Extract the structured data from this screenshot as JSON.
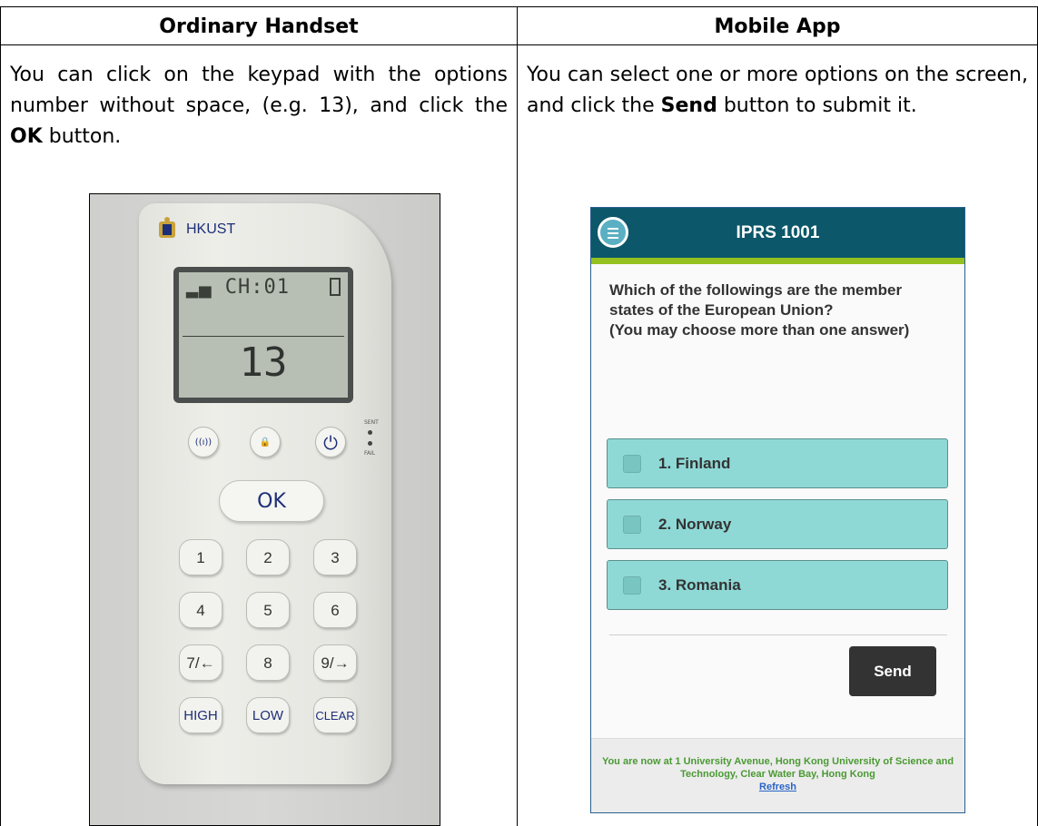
{
  "top_fragment": "",
  "left": {
    "title": "Ordinary Handset",
    "text_before_ok": "You can click on the keypad with the options number without space, (e.g. 13), and click the ",
    "ok_word": "OK",
    "text_after_ok": " button.",
    "handset": {
      "brand": "HKUST",
      "lcd_channel": "CH:01",
      "lcd_value": "13",
      "btn_channel": "CHANNEL",
      "btn_user": "USER ID",
      "led_sent": "SENT",
      "led_fail": "FAIL",
      "ok_label": "OK",
      "keys": [
        "1",
        "2",
        "3",
        "4",
        "5",
        "6",
        "7/←",
        "8",
        "9/→",
        "HIGH",
        "LOW",
        "CLEAR"
      ]
    }
  },
  "right": {
    "title": "Mobile App",
    "text_before_send": "You can select one or more options on the screen, and click the ",
    "send_word": "Send",
    "text_after_send": " button to submit it.",
    "app": {
      "title": "IPRS 1001",
      "question": "Which of the followings are the member states of the European Union?\n(You may choose more than one answer)",
      "options": [
        "1. Finland",
        "2. Norway",
        "3. Romania"
      ],
      "send_label": "Send",
      "footer_text": "You are now at 1 University Avenue, Hong Kong University of Science and Technology, Clear Water Bay, Hong Kong",
      "footer_link": "Refresh",
      "colors": {
        "header": "#0c5769",
        "accent": "#94c11f",
        "option_bg": "#8ed9d6",
        "send_bg": "#333333",
        "footer_text": "#4a9a33",
        "link": "#2a64c8"
      }
    }
  }
}
